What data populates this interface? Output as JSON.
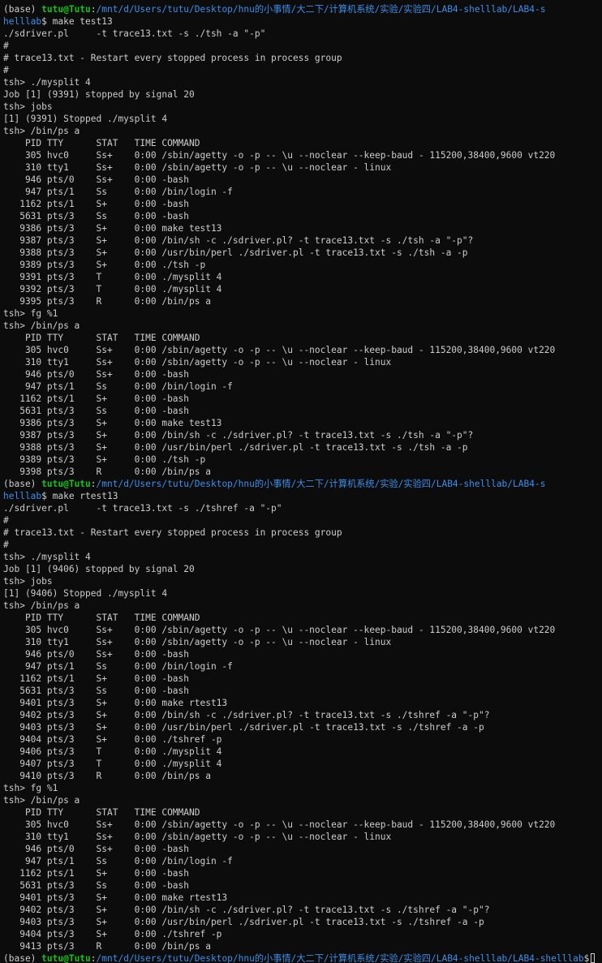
{
  "terminal": {
    "lines": [
      {
        "segs": [
          {
            "t": "(base) "
          },
          {
            "t": "tutu@Tutu",
            "c": "grn"
          },
          {
            "t": ":"
          },
          {
            "t": "/mnt/d/Users/tutu/Desktop/hnu的小事情/大二下/计算机系统/实验/实验四/LAB4-shelllab/LAB4-s",
            "c": "blu"
          }
        ]
      },
      {
        "segs": [
          {
            "t": "helllab",
            "c": "blu"
          },
          {
            "t": "$ make test13"
          }
        ]
      },
      {
        "segs": [
          {
            "t": "./sdriver.pl     -t trace13.txt -s ./tsh -a \"-p\""
          }
        ]
      },
      {
        "segs": [
          {
            "t": "#"
          }
        ]
      },
      {
        "segs": [
          {
            "t": "# trace13.txt - Restart every stopped process in process group"
          }
        ]
      },
      {
        "segs": [
          {
            "t": "#"
          }
        ]
      },
      {
        "segs": [
          {
            "t": "tsh> ./mysplit 4"
          }
        ]
      },
      {
        "segs": [
          {
            "t": "Job [1] (9391) stopped by signal 20"
          }
        ]
      },
      {
        "segs": [
          {
            "t": "tsh> jobs"
          }
        ]
      },
      {
        "segs": [
          {
            "t": "[1] (9391) Stopped ./mysplit 4"
          }
        ]
      },
      {
        "segs": [
          {
            "t": "tsh> /bin/ps a"
          }
        ]
      },
      {
        "segs": [
          {
            "t": "    PID TTY      STAT   TIME COMMAND"
          }
        ]
      },
      {
        "segs": [
          {
            "t": "    305 hvc0     Ss+    0:00 /sbin/agetty -o -p -- \\u --noclear --keep-baud - 115200,38400,9600 vt220"
          }
        ]
      },
      {
        "segs": [
          {
            "t": "    310 tty1     Ss+    0:00 /sbin/agetty -o -p -- \\u --noclear - linux"
          }
        ]
      },
      {
        "segs": [
          {
            "t": "    946 pts/0    Ss+    0:00 -bash"
          }
        ]
      },
      {
        "segs": [
          {
            "t": "    947 pts/1    Ss     0:00 /bin/login -f"
          }
        ]
      },
      {
        "segs": [
          {
            "t": "   1162 pts/1    S+     0:00 -bash"
          }
        ]
      },
      {
        "segs": [
          {
            "t": "   5631 pts/3    Ss     0:00 -bash"
          }
        ]
      },
      {
        "segs": [
          {
            "t": "   9386 pts/3    S+     0:00 make test13"
          }
        ]
      },
      {
        "segs": [
          {
            "t": "   9387 pts/3    S+     0:00 /bin/sh -c ./sdriver.pl? -t trace13.txt -s ./tsh -a \"-p\"?"
          }
        ]
      },
      {
        "segs": [
          {
            "t": "   9388 pts/3    S+     0:00 /usr/bin/perl ./sdriver.pl -t trace13.txt -s ./tsh -a -p"
          }
        ]
      },
      {
        "segs": [
          {
            "t": "   9389 pts/3    S+     0:00 ./tsh -p"
          }
        ]
      },
      {
        "segs": [
          {
            "t": "   9391 pts/3    T      0:00 ./mysplit 4"
          }
        ]
      },
      {
        "segs": [
          {
            "t": "   9392 pts/3    T      0:00 ./mysplit 4"
          }
        ]
      },
      {
        "segs": [
          {
            "t": "   9395 pts/3    R      0:00 /bin/ps a"
          }
        ]
      },
      {
        "segs": [
          {
            "t": "tsh> fg %1"
          }
        ]
      },
      {
        "segs": [
          {
            "t": "tsh> /bin/ps a"
          }
        ]
      },
      {
        "segs": [
          {
            "t": "    PID TTY      STAT   TIME COMMAND"
          }
        ]
      },
      {
        "segs": [
          {
            "t": "    305 hvc0     Ss+    0:00 /sbin/agetty -o -p -- \\u --noclear --keep-baud - 115200,38400,9600 vt220"
          }
        ]
      },
      {
        "segs": [
          {
            "t": "    310 tty1     Ss+    0:00 /sbin/agetty -o -p -- \\u --noclear - linux"
          }
        ]
      },
      {
        "segs": [
          {
            "t": "    946 pts/0    Ss+    0:00 -bash"
          }
        ]
      },
      {
        "segs": [
          {
            "t": "    947 pts/1    Ss     0:00 /bin/login -f"
          }
        ]
      },
      {
        "segs": [
          {
            "t": "   1162 pts/1    S+     0:00 -bash"
          }
        ]
      },
      {
        "segs": [
          {
            "t": "   5631 pts/3    Ss     0:00 -bash"
          }
        ]
      },
      {
        "segs": [
          {
            "t": "   9386 pts/3    S+     0:00 make test13"
          }
        ]
      },
      {
        "segs": [
          {
            "t": "   9387 pts/3    S+     0:00 /bin/sh -c ./sdriver.pl? -t trace13.txt -s ./tsh -a \"-p\"?"
          }
        ]
      },
      {
        "segs": [
          {
            "t": "   9388 pts/3    S+     0:00 /usr/bin/perl ./sdriver.pl -t trace13.txt -s ./tsh -a -p"
          }
        ]
      },
      {
        "segs": [
          {
            "t": "   9389 pts/3    S+     0:00 ./tsh -p"
          }
        ]
      },
      {
        "segs": [
          {
            "t": "   9398 pts/3    R      0:00 /bin/ps a"
          }
        ]
      },
      {
        "segs": [
          {
            "t": "(base) "
          },
          {
            "t": "tutu@Tutu",
            "c": "grn"
          },
          {
            "t": ":"
          },
          {
            "t": "/mnt/d/Users/tutu/Desktop/hnu的小事情/大二下/计算机系统/实验/实验四/LAB4-shelllab/LAB4-s",
            "c": "blu"
          }
        ]
      },
      {
        "segs": [
          {
            "t": "helllab",
            "c": "blu"
          },
          {
            "t": "$ make rtest13"
          }
        ]
      },
      {
        "segs": [
          {
            "t": "./sdriver.pl     -t trace13.txt -s ./tshref -a \"-p\""
          }
        ]
      },
      {
        "segs": [
          {
            "t": "#"
          }
        ]
      },
      {
        "segs": [
          {
            "t": "# trace13.txt - Restart every stopped process in process group"
          }
        ]
      },
      {
        "segs": [
          {
            "t": "#"
          }
        ]
      },
      {
        "segs": [
          {
            "t": "tsh> ./mysplit 4"
          }
        ]
      },
      {
        "segs": [
          {
            "t": "Job [1] (9406) stopped by signal 20"
          }
        ]
      },
      {
        "segs": [
          {
            "t": "tsh> jobs"
          }
        ]
      },
      {
        "segs": [
          {
            "t": "[1] (9406) Stopped ./mysplit 4"
          }
        ]
      },
      {
        "segs": [
          {
            "t": "tsh> /bin/ps a"
          }
        ]
      },
      {
        "segs": [
          {
            "t": "    PID TTY      STAT   TIME COMMAND"
          }
        ]
      },
      {
        "segs": [
          {
            "t": "    305 hvc0     Ss+    0:00 /sbin/agetty -o -p -- \\u --noclear --keep-baud - 115200,38400,9600 vt220"
          }
        ]
      },
      {
        "segs": [
          {
            "t": "    310 tty1     Ss+    0:00 /sbin/agetty -o -p -- \\u --noclear - linux"
          }
        ]
      },
      {
        "segs": [
          {
            "t": "    946 pts/0    Ss+    0:00 -bash"
          }
        ]
      },
      {
        "segs": [
          {
            "t": "    947 pts/1    Ss     0:00 /bin/login -f"
          }
        ]
      },
      {
        "segs": [
          {
            "t": "   1162 pts/1    S+     0:00 -bash"
          }
        ]
      },
      {
        "segs": [
          {
            "t": "   5631 pts/3    Ss     0:00 -bash"
          }
        ]
      },
      {
        "segs": [
          {
            "t": "   9401 pts/3    S+     0:00 make rtest13"
          }
        ]
      },
      {
        "segs": [
          {
            "t": "   9402 pts/3    S+     0:00 /bin/sh -c ./sdriver.pl? -t trace13.txt -s ./tshref -a \"-p\"?"
          }
        ]
      },
      {
        "segs": [
          {
            "t": "   9403 pts/3    S+     0:00 /usr/bin/perl ./sdriver.pl -t trace13.txt -s ./tshref -a -p"
          }
        ]
      },
      {
        "segs": [
          {
            "t": "   9404 pts/3    S+     0:00 ./tshref -p"
          }
        ]
      },
      {
        "segs": [
          {
            "t": "   9406 pts/3    T      0:00 ./mysplit 4"
          }
        ]
      },
      {
        "segs": [
          {
            "t": "   9407 pts/3    T      0:00 ./mysplit 4"
          }
        ]
      },
      {
        "segs": [
          {
            "t": "   9410 pts/3    R      0:00 /bin/ps a"
          }
        ]
      },
      {
        "segs": [
          {
            "t": "tsh> fg %1"
          }
        ]
      },
      {
        "segs": [
          {
            "t": "tsh> /bin/ps a"
          }
        ]
      },
      {
        "segs": [
          {
            "t": "    PID TTY      STAT   TIME COMMAND"
          }
        ]
      },
      {
        "segs": [
          {
            "t": "    305 hvc0     Ss+    0:00 /sbin/agetty -o -p -- \\u --noclear --keep-baud - 115200,38400,9600 vt220"
          }
        ]
      },
      {
        "segs": [
          {
            "t": "    310 tty1     Ss+    0:00 /sbin/agetty -o -p -- \\u --noclear - linux"
          }
        ]
      },
      {
        "segs": [
          {
            "t": "    946 pts/0    Ss+    0:00 -bash"
          }
        ]
      },
      {
        "segs": [
          {
            "t": "    947 pts/1    Ss     0:00 /bin/login -f"
          }
        ]
      },
      {
        "segs": [
          {
            "t": "   1162 pts/1    S+     0:00 -bash"
          }
        ]
      },
      {
        "segs": [
          {
            "t": "   5631 pts/3    Ss     0:00 -bash"
          }
        ]
      },
      {
        "segs": [
          {
            "t": "   9401 pts/3    S+     0:00 make rtest13"
          }
        ]
      },
      {
        "segs": [
          {
            "t": "   9402 pts/3    S+     0:00 /bin/sh -c ./sdriver.pl? -t trace13.txt -s ./tshref -a \"-p\"?"
          }
        ]
      },
      {
        "segs": [
          {
            "t": "   9403 pts/3    S+     0:00 /usr/bin/perl ./sdriver.pl -t trace13.txt -s ./tshref -a -p"
          }
        ]
      },
      {
        "segs": [
          {
            "t": "   9404 pts/3    S+     0:00 ./tshref -p"
          }
        ]
      },
      {
        "segs": [
          {
            "t": "   9413 pts/3    R      0:00 /bin/ps a"
          }
        ]
      },
      {
        "segs": [
          {
            "t": "(base) "
          },
          {
            "t": "tutu@Tutu",
            "c": "grn"
          },
          {
            "t": ":"
          },
          {
            "t": "/mnt/d/Users/tutu/Desktop/hnu的小事情/大二下/计算机系统/实验/实验四/LAB4-shelllab/LAB4-shelllab",
            "c": "blu"
          },
          {
            "t": "$"
          }
        ],
        "cursor": true
      }
    ]
  },
  "colors": {
    "background": "#0c0c0c",
    "foreground": "#cccccc",
    "prompt_user": "#13c313",
    "prompt_path": "#3b8eea"
  }
}
